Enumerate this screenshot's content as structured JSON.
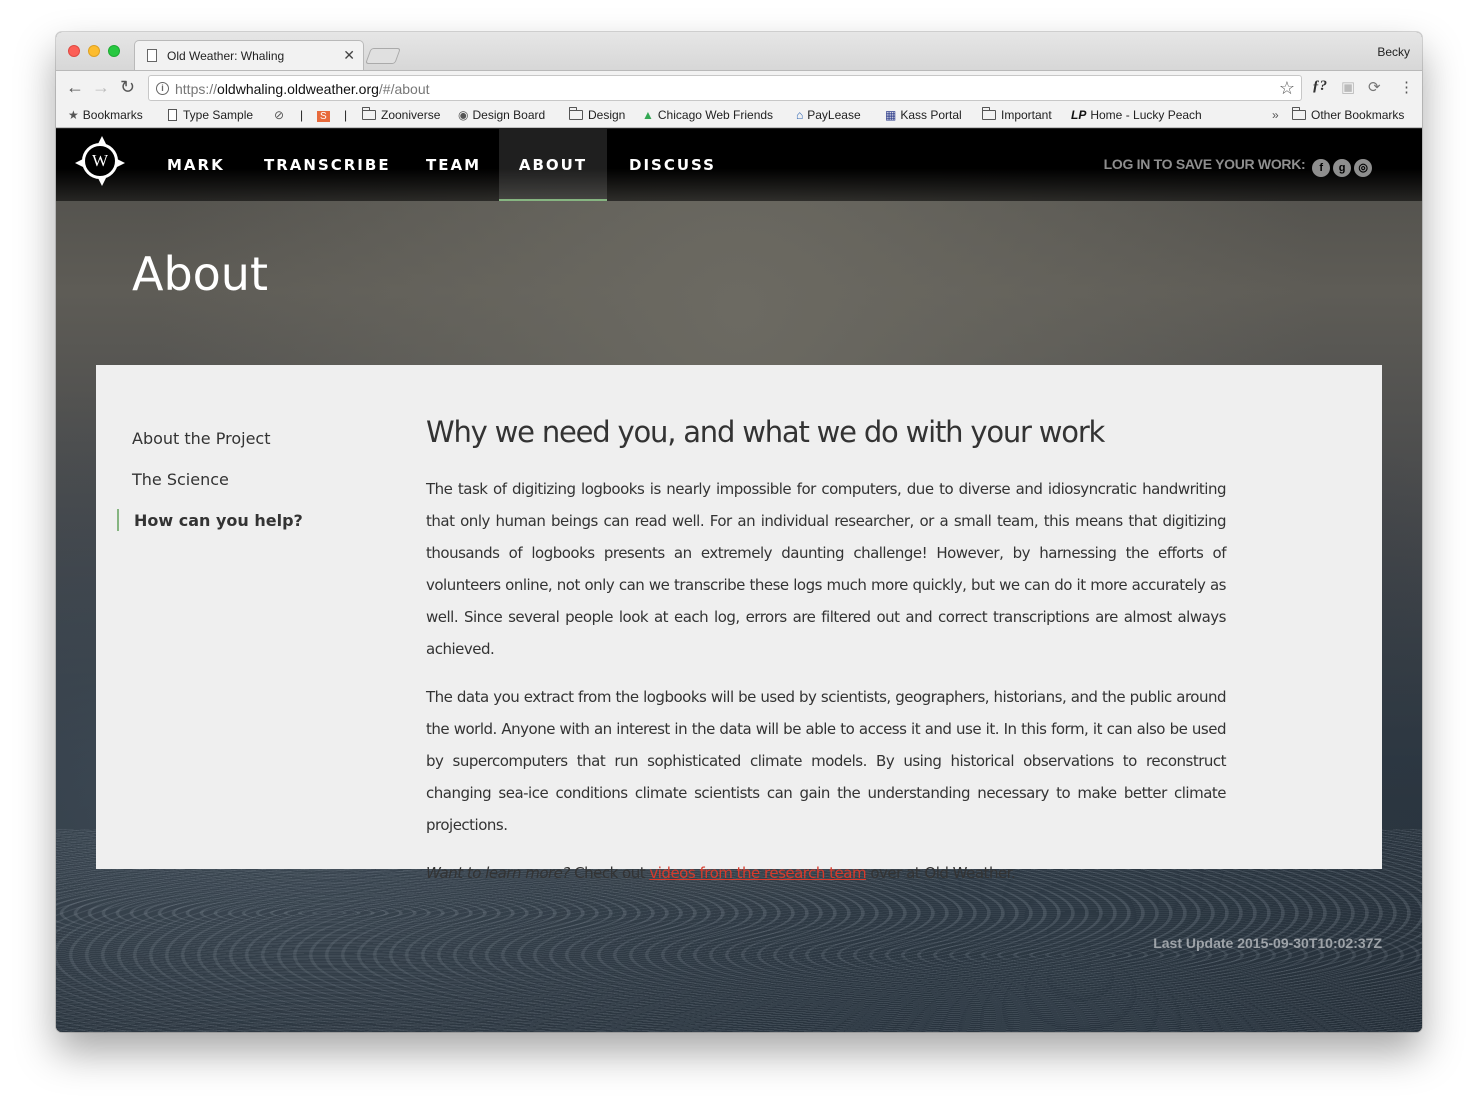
{
  "browser": {
    "tab_title": "Old Weather: Whaling",
    "tab_close": "✕",
    "profile": "Becky",
    "url_scheme": "https://",
    "url_host": "oldwhaling.oldweather.org",
    "url_path": "/#/about"
  },
  "bookmarks": [
    {
      "label": "Bookmarks",
      "icon": "star-icon"
    },
    {
      "label": "Type Sample",
      "icon": "page-icon"
    },
    {
      "label": "Zooniverse",
      "icon": "folder-icon"
    },
    {
      "label": "Design Board",
      "icon": "github-icon"
    },
    {
      "label": "Design",
      "icon": "folder-icon"
    },
    {
      "label": "Chicago Web Friends",
      "icon": "drive-icon"
    },
    {
      "label": "PayLease",
      "icon": "house-icon"
    },
    {
      "label": "Kass Portal",
      "icon": "building-icon"
    },
    {
      "label": "Important",
      "icon": "folder-icon"
    },
    {
      "label": "Home - Lucky Peach",
      "icon": "lp-icon"
    },
    {
      "label": "Other Bookmarks",
      "icon": "folder-icon"
    }
  ],
  "bookmark_separator": "|",
  "bookmark_overflow": "»",
  "site": {
    "logo_letter": "W",
    "nav": [
      "MARK",
      "TRANSCRIBE",
      "TEAM",
      "ABOUT",
      "DISCUSS"
    ],
    "active_nav": "ABOUT",
    "login_text": "LOG IN TO SAVE YOUR WORK:",
    "social": [
      "f",
      "g",
      "◎"
    ],
    "page_title": "About",
    "sidebar": [
      "About the Project",
      "The Science",
      "How can you help?"
    ],
    "heading": "Why we need you, and what we do with your work",
    "paragraph1": "The task of digitizing logbooks is nearly impossible for computers, due to diverse and idiosyncratic handwriting that only human beings can read well. For an individual researcher, or a small team, this means that digitizing thousands of logbooks presents an extremely daunting challenge! However, by harnessing the efforts of volunteers online, not only can we transcribe these logs much more quickly, but we can do it more accurately as well. Since several people look at each log, errors are filtered out and correct transcriptions are almost always achieved.",
    "paragraph2": "The data you extract from the logbooks will be used by scientists, geographers, historians, and the public around the world. Anyone with an interest in the data will be able to access it and use it. In this form, it can also be used by supercomputers that run sophisticated climate models. By using historical observations to reconstruct changing sea-ice conditions climate scientists can gain the understanding necessary to make better climate projections.",
    "learn_more_em": "Want to learn more?",
    "learn_more_pre": " Check out ",
    "learn_more_link": "videos from the research team",
    "learn_more_post": " over at Old Weather.",
    "last_update": "Last Update 2015-09-30T10:02:37Z",
    "accent": "#86b581",
    "link_color": "#d83a2b"
  }
}
